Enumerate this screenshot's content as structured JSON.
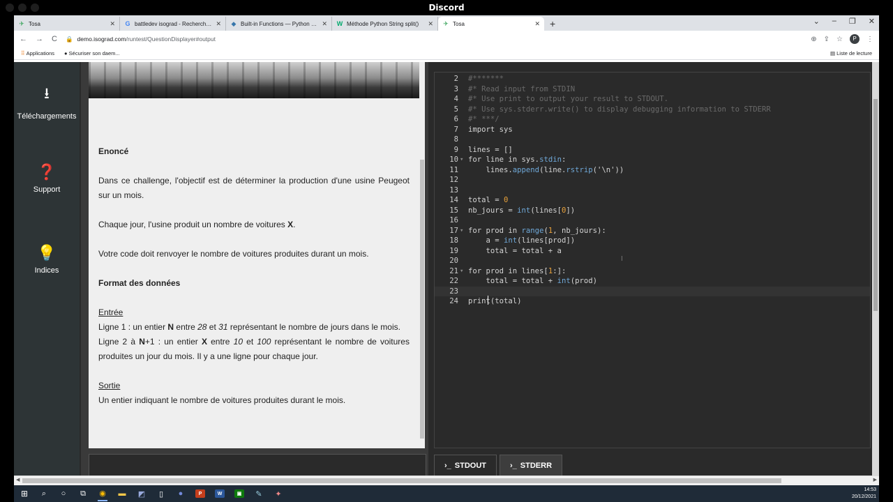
{
  "discord": {
    "title": "Discord"
  },
  "browser": {
    "tabs": [
      {
        "favicon": "tosa-icon",
        "title": "Tosa",
        "active": false
      },
      {
        "favicon": "google-icon",
        "title": "battledev isograd - Recherche G",
        "active": false
      },
      {
        "favicon": "python-icon",
        "title": "Built-in Functions — Python 3.1(",
        "active": false
      },
      {
        "favicon": "w3schools-icon",
        "title": "Méthode Python String split()",
        "active": false
      },
      {
        "favicon": "tosa-icon",
        "title": "Tosa",
        "active": true
      }
    ],
    "url_host": "demo.isograd.com",
    "url_path": "/runtest/QuestionDisplayer#output",
    "bookmarks": {
      "apps": "Applications",
      "item1": "Sécuriser son daem...",
      "reading_list": "Liste de lecture"
    },
    "profile_initial": "P"
  },
  "sidebar": {
    "items": [
      {
        "icon": "download-icon",
        "label": "Téléchargements"
      },
      {
        "icon": "help-icon",
        "label": "Support"
      },
      {
        "icon": "lightbulb-icon",
        "label": "Indices"
      }
    ]
  },
  "statement": {
    "title": "Enoncé",
    "p1": "Dans ce challenge, l'objectif est de déterminer la production d'une usine Peugeot sur un mois.",
    "p2_a": "Chaque jour, l'usine produit un nombre de voitures ",
    "p2_b": "X",
    "p2_c": ".",
    "p3": "Votre code doit renvoyer le nombre de voitures produites durant un mois.",
    "format_title": "Format des données",
    "input_title": "Entrée",
    "line1_a": "Ligne 1 : un entier ",
    "line1_b": "N",
    "line1_c": " entre ",
    "line1_d": "28",
    "line1_e": " et ",
    "line1_f": "31",
    "line1_g": " représentant le nombre de jours dans le mois.",
    "line2_a": "Ligne 2 à ",
    "line2_b": "N",
    "line2_c": "+1 : un entier ",
    "line2_d": "X",
    "line2_e": " entre ",
    "line2_f": "10",
    "line2_g": " et ",
    "line2_h": "100",
    "line2_i": " représentant le nombre de voitures produites un jour du mois. Il y a une ligne pour chaque jour.",
    "output_title": "Sortie",
    "output_text": "Un entier indiquant le nombre de voitures produites durant le mois."
  },
  "editor": {
    "lines": [
      {
        "n": "2",
        "text": "#*******"
      },
      {
        "n": "3",
        "text": "#* Read input from STDIN"
      },
      {
        "n": "4",
        "text": "#* Use print to output your result to STDOUT."
      },
      {
        "n": "5",
        "text": "#* Use sys.stderr.write() to display debugging information to STDERR"
      },
      {
        "n": "6",
        "text": "#* ***/"
      },
      {
        "n": "7",
        "text": "import sys"
      },
      {
        "n": "8",
        "text": ""
      },
      {
        "n": "9",
        "text": "lines = []"
      },
      {
        "n": "10",
        "text": "for line in sys.stdin:"
      },
      {
        "n": "11",
        "text": "    lines.append(line.rstrip('\\n'))"
      },
      {
        "n": "12",
        "text": ""
      },
      {
        "n": "13",
        "text": ""
      },
      {
        "n": "14",
        "text": "total = 0"
      },
      {
        "n": "15",
        "text": "nb_jours = int(lines[0])"
      },
      {
        "n": "16",
        "text": ""
      },
      {
        "n": "17",
        "text": "for prod in range(1, nb_jours):"
      },
      {
        "n": "18",
        "text": "    a = int(lines[prod])"
      },
      {
        "n": "19",
        "text": "    total = total + a"
      },
      {
        "n": "20",
        "text": ""
      },
      {
        "n": "21",
        "text": "for prod in lines[1:]:"
      },
      {
        "n": "22",
        "text": "    total = total + int(prod)"
      },
      {
        "n": "23",
        "text": "    "
      },
      {
        "n": "24",
        "text": "print(total)"
      }
    ],
    "fold_lines": [
      "10",
      "17",
      "21"
    ],
    "active_line": "23"
  },
  "output_tabs": [
    {
      "icon": "terminal-icon",
      "label": "STDOUT",
      "active": false
    },
    {
      "icon": "terminal-icon",
      "label": "STDERR",
      "active": true
    }
  ],
  "taskbar": {
    "time": "14:53",
    "date": "20/12/2021"
  }
}
